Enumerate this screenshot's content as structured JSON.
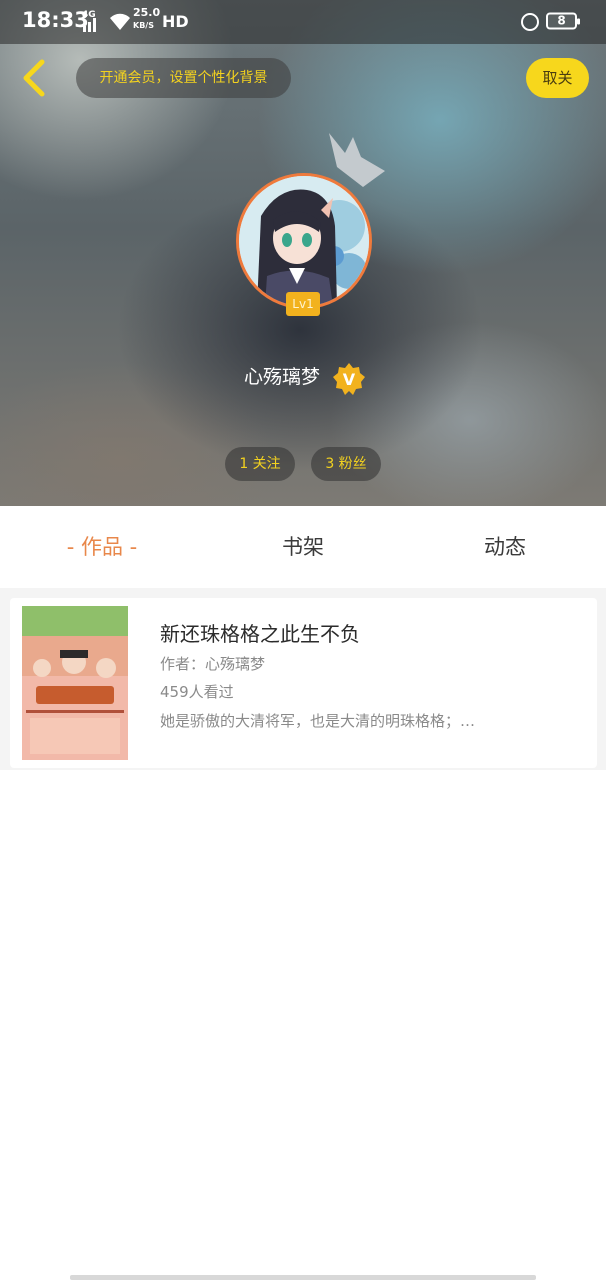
{
  "status_bar": {
    "time": "18:33",
    "network": "4G",
    "speed_value": "25.0",
    "speed_unit": "KB/S",
    "hd": "HD",
    "battery": "8"
  },
  "header": {
    "vip_banner": "开通会员，设置个性化背景",
    "cancel_label": "取关",
    "level": "Lv1",
    "username": "心殇璃梦",
    "v_badge": "V",
    "follow_count": "1 关注",
    "fans_count": "3 粉丝"
  },
  "tabs": [
    {
      "label": "- 作品 -",
      "active": true
    },
    {
      "label": "书架",
      "active": false
    },
    {
      "label": "动态",
      "active": false
    }
  ],
  "works": [
    {
      "title": "新还珠格格之此生不负",
      "author": "作者：心殇璃梦",
      "views": "459人看过",
      "description": "她是骄傲的大清将军，也是大清的明珠格格；…"
    }
  ],
  "colors": {
    "accent_yellow": "#f7d71c",
    "tab_active": "#e8874a",
    "avatar_ring": "#ef7a3c",
    "level_badge": "#f2b21e"
  },
  "icons": {
    "back": "chevron-left-icon",
    "crown": "crown-icon",
    "vip": "v-badge-icon"
  }
}
